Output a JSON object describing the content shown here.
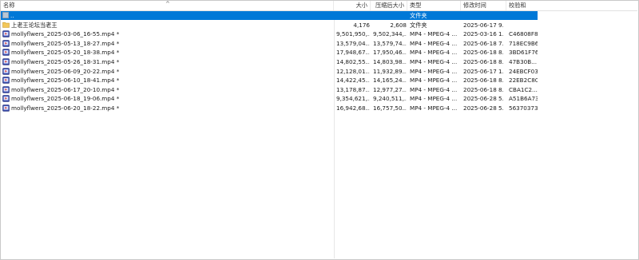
{
  "columns": {
    "name": "名称",
    "size": "大小",
    "packed": "压缩后大小",
    "type": "类型",
    "modified": "修改时间",
    "crc": "校验和"
  },
  "rows": [
    {
      "icon": "parent-folder-icon",
      "name": "..",
      "size": "",
      "packed": "",
      "type": "文件夹",
      "modified": "",
      "crc": ""
    },
    {
      "icon": "folder-icon",
      "name": "上老王论坛当老王",
      "size": "4,176",
      "packed": "2,608",
      "type": "文件夹",
      "modified": "2025-06-17 9...",
      "crc": ""
    },
    {
      "icon": "video-file-icon",
      "name": "mollyflwers_2025-03-06_16-55.mp4 *",
      "size": "9,501,950,...",
      "packed": "9,502,344,...",
      "type": "MP4 - MPEG-4 ...",
      "modified": "2025-03-16 1...",
      "crc": "C46808F8"
    },
    {
      "icon": "video-file-icon",
      "name": "mollyflwers_2025-05-13_18-27.mp4 *",
      "size": "13,579,04...",
      "packed": "13,579,74...",
      "type": "MP4 - MPEG-4 ...",
      "modified": "2025-06-18 7...",
      "crc": "718EC9B6"
    },
    {
      "icon": "video-file-icon",
      "name": "mollyflwers_2025-05-20_18-38.mp4 *",
      "size": "17,948,67...",
      "packed": "17,950,46...",
      "type": "MP4 - MPEG-4 ...",
      "modified": "2025-06-18 8...",
      "crc": "3BD61F76"
    },
    {
      "icon": "video-file-icon",
      "name": "mollyflwers_2025-05-26_18-31.mp4 *",
      "size": "14,802,55...",
      "packed": "14,803,98...",
      "type": "MP4 - MPEG-4 ...",
      "modified": "2025-06-18 8...",
      "crc": "47B30B..."
    },
    {
      "icon": "video-file-icon",
      "name": "mollyflwers_2025-06-09_20-22.mp4 *",
      "size": "12,128,01...",
      "packed": "11,932,89...",
      "type": "MP4 - MPEG-4 ...",
      "modified": "2025-06-17 1...",
      "crc": "24EBCF03"
    },
    {
      "icon": "video-file-icon",
      "name": "mollyflwers_2025-06-10_18-41.mp4 *",
      "size": "14,422,45...",
      "packed": "14,165,24...",
      "type": "MP4 - MPEG-4 ...",
      "modified": "2025-06-18 8...",
      "crc": "22EB2C80"
    },
    {
      "icon": "video-file-icon",
      "name": "mollyflwers_2025-06-17_20-10.mp4 *",
      "size": "13,178,87...",
      "packed": "12,977,27...",
      "type": "MP4 - MPEG-4 ...",
      "modified": "2025-06-18 8...",
      "crc": "CBA1C2..."
    },
    {
      "icon": "video-file-icon",
      "name": "mollyflwers_2025-06-18_19-06.mp4 *",
      "size": "9,354,621,...",
      "packed": "9,240,511,...",
      "type": "MP4 - MPEG-4 ...",
      "modified": "2025-06-28 5...",
      "crc": "A51B6A73"
    },
    {
      "icon": "video-file-icon",
      "name": "mollyflwers_2025-06-20_18-22.mp4 *",
      "size": "16,942,68...",
      "packed": "16,757,50...",
      "type": "MP4 - MPEG-4 ...",
      "modified": "2025-06-28 5...",
      "crc": "56370373"
    }
  ],
  "selected_row": 0,
  "colors": {
    "selection": "#0078d7",
    "folder": "#f3c85a",
    "video": "#3a4aa8"
  }
}
